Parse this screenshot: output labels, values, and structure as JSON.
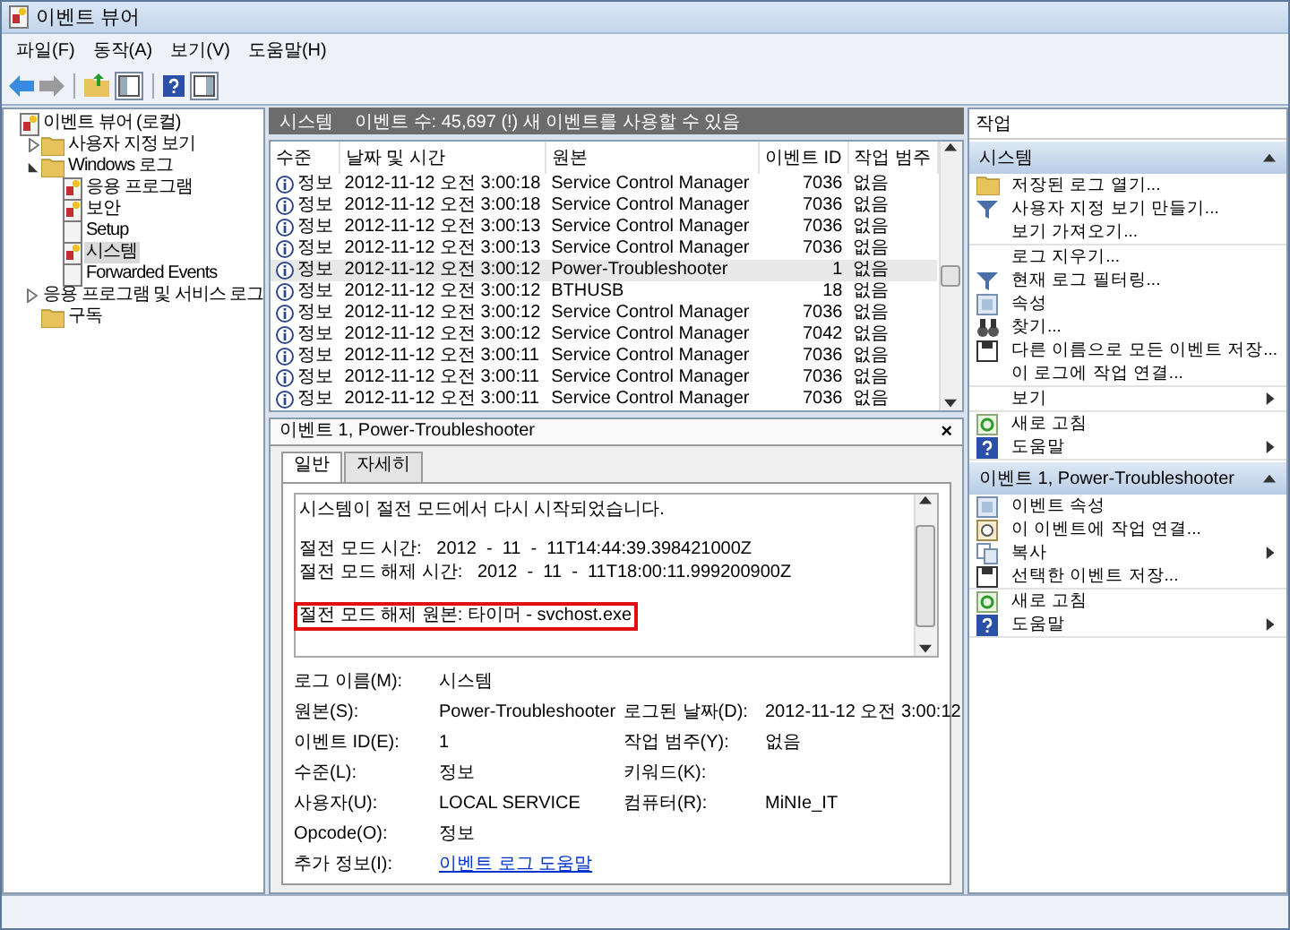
{
  "window": {
    "title": "이벤트 뷰어"
  },
  "menu": [
    "파일(F)",
    "동작(A)",
    "보기(V)",
    "도움말(H)"
  ],
  "tree": [
    {
      "label": "이벤트 뷰어 (로컬)",
      "kind": "root",
      "selected": false,
      "children": [
        {
          "label": "사용자 지정 보기",
          "kind": "folder",
          "expanded": false,
          "selected": false
        },
        {
          "label": "Windows 로그",
          "kind": "folder",
          "expanded": true,
          "selected": false,
          "children": [
            {
              "label": "응용 프로그램",
              "kind": "log",
              "selected": false
            },
            {
              "label": "보안",
              "kind": "log",
              "selected": false
            },
            {
              "label": "Setup",
              "kind": "empty_log",
              "selected": false
            },
            {
              "label": "시스템",
              "kind": "log",
              "selected": true
            },
            {
              "label": "Forwarded Events",
              "kind": "empty_log",
              "selected": false
            }
          ]
        },
        {
          "label": "응용 프로그램 및 서비스 로그",
          "kind": "folder",
          "expanded": false,
          "selected": false
        },
        {
          "label": "구독",
          "kind": "folder",
          "selected": false
        }
      ]
    }
  ],
  "log_header": {
    "title": "시스템",
    "summary": "이벤트 수: 45,697 (!) 새 이벤트를 사용할 수 있음"
  },
  "table": {
    "columns": [
      "수준",
      "날짜 및 시간",
      "원본",
      "이벤트 ID",
      "작업 범주"
    ],
    "rows": [
      {
        "level": "정보",
        "date": "2012-11-12 오전 3:00:18",
        "source": "Service Control Manager",
        "id": "7036",
        "category": "없음",
        "selected": false
      },
      {
        "level": "정보",
        "date": "2012-11-12 오전 3:00:18",
        "source": "Service Control Manager",
        "id": "7036",
        "category": "없음",
        "selected": false
      },
      {
        "level": "정보",
        "date": "2012-11-12 오전 3:00:13",
        "source": "Service Control Manager",
        "id": "7036",
        "category": "없음",
        "selected": false
      },
      {
        "level": "정보",
        "date": "2012-11-12 오전 3:00:13",
        "source": "Service Control Manager",
        "id": "7036",
        "category": "없음",
        "selected": false
      },
      {
        "level": "정보",
        "date": "2012-11-12 오전 3:00:12",
        "source": "Power-Troubleshooter",
        "id": "1",
        "category": "없음",
        "selected": true
      },
      {
        "level": "정보",
        "date": "2012-11-12 오전 3:00:12",
        "source": "BTHUSB",
        "id": "18",
        "category": "없음",
        "selected": false
      },
      {
        "level": "정보",
        "date": "2012-11-12 오전 3:00:12",
        "source": "Service Control Manager",
        "id": "7036",
        "category": "없음",
        "selected": false
      },
      {
        "level": "정보",
        "date": "2012-11-12 오전 3:00:12",
        "source": "Service Control Manager",
        "id": "7042",
        "category": "없음",
        "selected": false
      },
      {
        "level": "정보",
        "date": "2012-11-12 오전 3:00:11",
        "source": "Service Control Manager",
        "id": "7036",
        "category": "없음",
        "selected": false
      },
      {
        "level": "정보",
        "date": "2012-11-12 오전 3:00:11",
        "source": "Service Control Manager",
        "id": "7036",
        "category": "없음",
        "selected": false
      },
      {
        "level": "정보",
        "date": "2012-11-12 오전 3:00:11",
        "source": "Service Control Manager",
        "id": "7036",
        "category": "없음",
        "selected": false
      }
    ]
  },
  "detail": {
    "title": "이벤트 1, Power-Troubleshooter",
    "close": "×",
    "tabs": [
      {
        "label": "일반",
        "selected": true
      },
      {
        "label": "자세히",
        "selected": false
      }
    ],
    "message": [
      {
        "lines": [
          "시스템이 절전 모드에서 다시 시작되었습니다."
        ],
        "highlighted": false
      },
      {
        "lines": [
          "절전 모드 시간:   2012  -  11  -  11T14:44:39.398421000Z",
          "절전 모드 해제 시간:   2012  -  11  -  11T18:00:11.999200900Z"
        ],
        "highlighted": false
      },
      {
        "lines": [
          "절전 모드 해제 원본: 타이머 - svchost.exe"
        ],
        "highlighted": true
      }
    ],
    "fields": [
      {
        "left": {
          "label": "로그 이름(M):",
          "value": "시스템"
        }
      },
      {
        "left": {
          "label": "원본(S):",
          "value": "Power-Troubleshooter"
        },
        "right": {
          "label": "로그된 날짜(D):",
          "value": "2012-11-12 오전 3:00:12"
        }
      },
      {
        "left": {
          "label": "이벤트 ID(E):",
          "value": "1"
        },
        "right": {
          "label": "작업 범주(Y):",
          "value": "없음"
        }
      },
      {
        "left": {
          "label": "수준(L):",
          "value": "정보"
        },
        "right": {
          "label": "키워드(K):"
        }
      },
      {
        "left": {
          "label": "사용자(U):",
          "value": "LOCAL SERVICE"
        },
        "right": {
          "label": "컴퓨터(R):",
          "value": "MiNIe_IT"
        }
      },
      {
        "left": {
          "label": "Opcode(O):",
          "value": "정보"
        }
      },
      {
        "left": {
          "label": "추가 정보(I):",
          "value": "이벤트 로그 도움말",
          "kind": "link"
        }
      }
    ]
  },
  "actions": {
    "title": "작업",
    "sections": [
      {
        "title": "시스템",
        "expanded": true,
        "groups": [
          [
            {
              "label": "저장된 로그 열기...",
              "submenu": false
            },
            {
              "label": "사용자 지정 보기 만들기...",
              "submenu": false
            },
            {
              "label": "보기 가져오기...",
              "submenu": false
            }
          ],
          [
            {
              "label": "로그 지우기...",
              "submenu": false
            },
            {
              "label": "현재 로그 필터링...",
              "submenu": false
            },
            {
              "label": "속성",
              "submenu": false
            },
            {
              "label": "찾기...",
              "submenu": false
            },
            {
              "label": "다른 이름으로 모든 이벤트 저장...",
              "submenu": false
            },
            {
              "label": "이 로그에 작업 연결...",
              "submenu": false
            }
          ],
          [
            {
              "label": "보기",
              "submenu": true
            }
          ],
          [
            {
              "label": "새로 고침",
              "submenu": false
            },
            {
              "label": "도움말",
              "submenu": true
            }
          ]
        ]
      },
      {
        "title": "이벤트 1, Power-Troubleshooter",
        "expanded": true,
        "groups": [
          [
            {
              "label": "이벤트 속성",
              "submenu": false
            },
            {
              "label": "이 이벤트에 작업 연결...",
              "submenu": false
            },
            {
              "label": "복사",
              "submenu": true
            },
            {
              "label": "선택한 이벤트 저장...",
              "submenu": false
            }
          ],
          [
            {
              "label": "새로 고침",
              "submenu": false
            },
            {
              "label": "도움말",
              "submenu": true
            }
          ]
        ]
      }
    ]
  }
}
